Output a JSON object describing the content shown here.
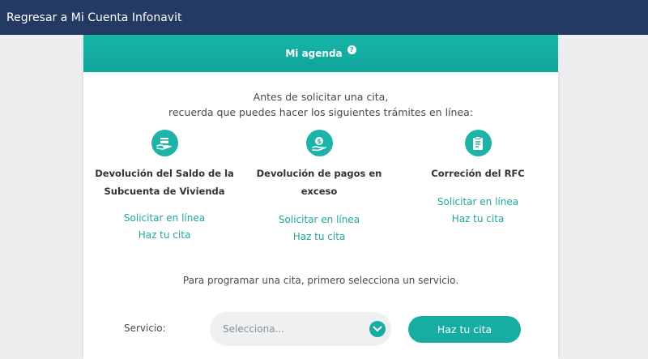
{
  "topbar": {
    "back_link": "Regresar a Mi Cuenta Infonavit"
  },
  "card": {
    "title": "Mi agenda",
    "help_icon": "?",
    "intro_line1": "Antes de solicitar una cita,",
    "intro_line2": "recuerda que puedes hacer los siguientes trámites en línea:",
    "services": [
      {
        "icon": "card-hand-icon",
        "title_line1": "Devolución del Saldo de la",
        "title_line2": "Subcuenta de Vivienda",
        "online": "Solicitar en línea",
        "appointment": "Haz tu cita"
      },
      {
        "icon": "money-hand-icon",
        "title_line1": "Devolución de pagos en exceso",
        "online": "Solicitar en línea",
        "appointment": "Haz tu cita"
      },
      {
        "icon": "clipboard-icon",
        "title_line1": "Correción del RFC",
        "online": "Solicitar en línea",
        "appointment": "Haz tu cita"
      }
    ],
    "prompt": "Para programar una cita, primero selecciona un servicio.",
    "service_label": "Servicio:",
    "select_placeholder": "Selecciona...",
    "cta": "Haz tu cita"
  },
  "colors": {
    "topbar": "#243a63",
    "accent": "#17ada2"
  }
}
